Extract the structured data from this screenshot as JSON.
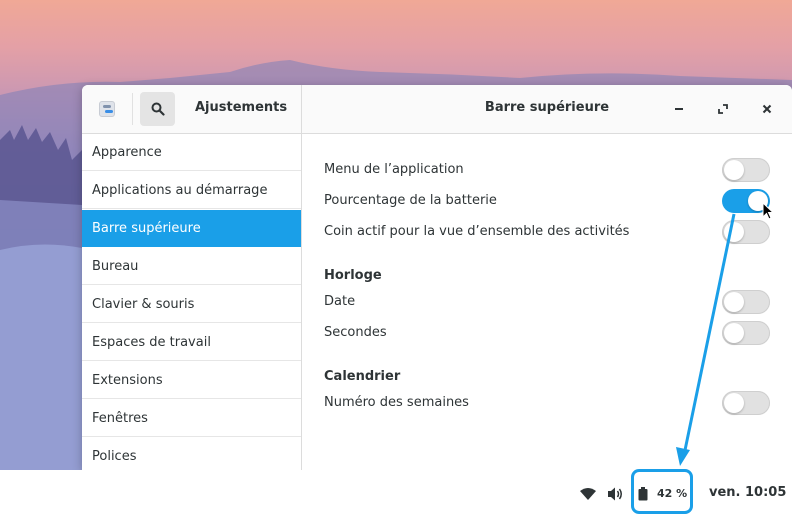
{
  "window": {
    "app_title": "Ajustements",
    "page_title": "Barre supérieure"
  },
  "sidebar": {
    "items": [
      {
        "label": "Apparence",
        "selected": false
      },
      {
        "label": "Applications au démarrage",
        "selected": false
      },
      {
        "label": "Barre supérieure",
        "selected": true
      },
      {
        "label": "Bureau",
        "selected": false
      },
      {
        "label": "Clavier & souris",
        "selected": false
      },
      {
        "label": "Espaces de travail",
        "selected": false
      },
      {
        "label": "Extensions",
        "selected": false
      },
      {
        "label": "Fenêtres",
        "selected": false
      },
      {
        "label": "Polices",
        "selected": false
      }
    ]
  },
  "settings": {
    "app_menu": {
      "label": "Menu de l’application",
      "enabled": false
    },
    "battery_percentage": {
      "label": "Pourcentage de la batterie",
      "enabled": true
    },
    "hot_corner": {
      "label": "Coin actif pour la vue d’ensemble des activités",
      "enabled": false
    },
    "clock_section": "Horloge",
    "date": {
      "label": "Date",
      "enabled": false
    },
    "seconds": {
      "label": "Secondes",
      "enabled": false
    },
    "calendar_section": "Calendrier",
    "week_numbers": {
      "label": "Numéro des semaines",
      "enabled": false
    }
  },
  "panel": {
    "battery_percent": "42 %",
    "clock": "ven. 10:05"
  },
  "icons": {
    "app": "tweaks-icon",
    "search": "search-icon",
    "minimize": "minimize-icon",
    "maximize": "maximize-icon",
    "close": "close-icon",
    "network": "wifi-icon",
    "volume": "volume-icon",
    "battery": "battery-icon"
  },
  "colors": {
    "accent": "#1a9fe8",
    "toggle_off": "#e1e1e1",
    "text": "#2e3436"
  }
}
